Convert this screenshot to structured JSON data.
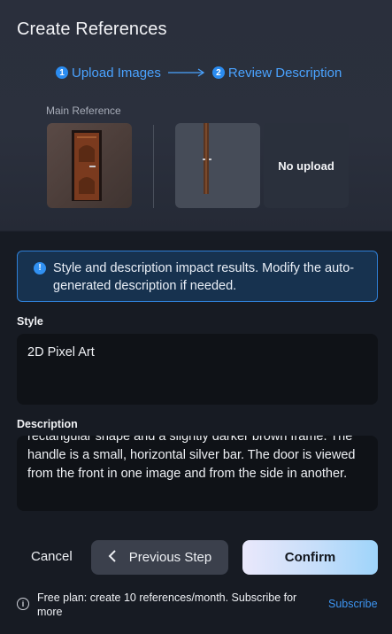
{
  "dialog": {
    "title": "Create References"
  },
  "steps": [
    {
      "number": "1",
      "label": "Upload Images"
    },
    {
      "number": "2",
      "label": "Review Description"
    }
  ],
  "references": {
    "main_label": "Main Reference",
    "empty_slot_label": "No upload"
  },
  "info": {
    "icon": "info-icon",
    "text": "Style and description impact results. Modify the auto-generated description if needed."
  },
  "style": {
    "label": "Style",
    "value": "2D Pixel Art"
  },
  "description": {
    "label": "Description",
    "value": "rectangular shape and a slightly darker brown frame. The handle is a small, horizontal silver bar. The door is viewed from the front in one image and from the side in another."
  },
  "actions": {
    "cancel": "Cancel",
    "previous": "Previous Step",
    "confirm": "Confirm"
  },
  "footer": {
    "text": "Free plan: create 10 references/month. Subscribe for more",
    "subscribe": "Subscribe"
  },
  "colors": {
    "accent": "#2b8cf0",
    "info_bg": "#17324f",
    "panel_bg": "#171b23"
  }
}
